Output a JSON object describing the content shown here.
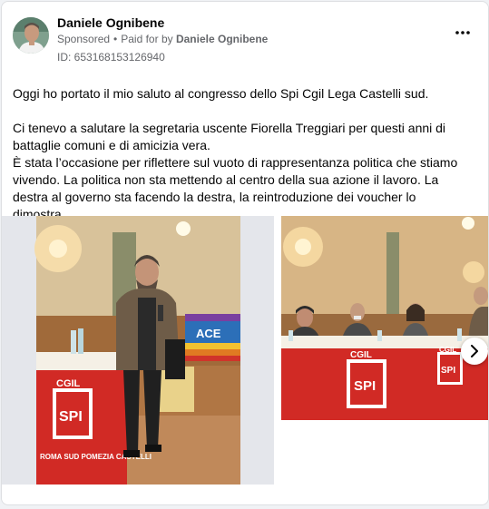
{
  "post": {
    "author": "Daniele Ognibene",
    "sponsored_label": "Sponsored",
    "paid_for_prefix": "Paid for by",
    "paid_for_by": "Daniele Ognibene",
    "ad_id": "ID: 653168153126940",
    "paragraph1": "Oggi ho portato il mio saluto al congresso dello Spi Cgil Lega Castelli sud.",
    "paragraph2": "Ci tenevo a salutare la segretaria uscente Fiorella Treggiari per questi anni di battaglie comuni e di amicizia vera.\nÈ stata l’occasione per riflettere sul vuoto di rappresentanza politica che stiamo vivendo. La politica non sta mettendo al centro della sua azione il lavoro. La destra al governo sta facendo la destra, la reintroduzione dei voucher lo dimostra.…"
  },
  "gallery": {
    "slide1_banner_text": "ACE",
    "slide1_logo_text": "SPI",
    "slide1_logo_top": "CGIL",
    "slide1_logo_sub": "ROMA SUD POMEZIA CASTELLI",
    "slide2_logo_text": "SPI",
    "slide2_logo_top": "CGIL",
    "slide2_logo_top_b": "CGIL",
    "slide2_logo_text_b": "SPI"
  },
  "icons": {
    "more": "more-icon",
    "next": "chevron-right-icon"
  }
}
